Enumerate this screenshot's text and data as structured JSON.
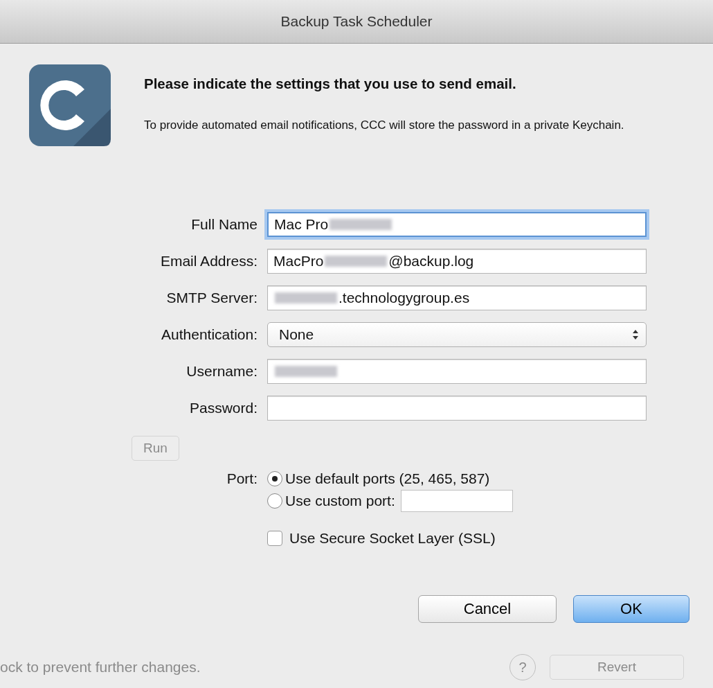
{
  "window": {
    "title": "Backup Task Scheduler"
  },
  "heading": "Please indicate the settings that you use to send email.",
  "description": "To provide automated email notifications, CCC will store the password in a private Keychain.",
  "fields": [
    {
      "kind": "text",
      "label": "Full Name",
      "focused": true,
      "value_parts": [
        {
          "kind": "text",
          "text": "Mac Pro"
        },
        {
          "kind": "redacted"
        }
      ]
    },
    {
      "kind": "text",
      "label": "Email Address:",
      "focused": false,
      "value_parts": [
        {
          "kind": "text",
          "text": "MacPro"
        },
        {
          "kind": "redacted"
        },
        {
          "kind": "text",
          "text": "@backup.log"
        }
      ]
    },
    {
      "kind": "text",
      "label": "SMTP Server:",
      "focused": false,
      "value_parts": [
        {
          "kind": "redacted"
        },
        {
          "kind": "text",
          "text": ".technologygroup.es"
        }
      ]
    },
    {
      "kind": "popup",
      "label": "Authentication:",
      "value": "None"
    },
    {
      "kind": "text",
      "label": "Username:",
      "focused": false,
      "value_parts": [
        {
          "kind": "redacted"
        }
      ]
    },
    {
      "kind": "text",
      "label": "Password:",
      "focused": false
    }
  ],
  "port": {
    "label": "Port:",
    "options": [
      {
        "kind": "plain",
        "label": "Use default ports (25, 465, 587)",
        "selected": true
      },
      {
        "kind": "with_field",
        "label": "Use custom port:",
        "selected": false
      }
    ]
  },
  "ssl": {
    "label": "Use Secure Socket Layer (SSL)",
    "checked": false
  },
  "buttons": [
    {
      "label": "Cancel",
      "default": false
    },
    {
      "label": "OK",
      "default": true
    }
  ],
  "background": {
    "run_button": "Run",
    "footer_text": "ock to prevent further changes.",
    "help_button": "?",
    "revert_button": "Revert"
  }
}
